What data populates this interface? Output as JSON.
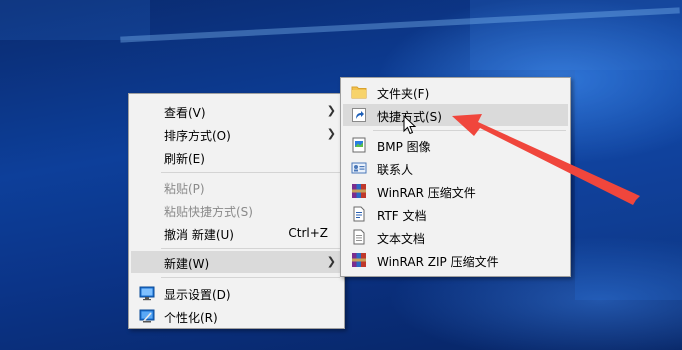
{
  "context_menu": {
    "items": [
      {
        "label": "查看(V)",
        "has_submenu": true
      },
      {
        "label": "排序方式(O)",
        "has_submenu": true
      },
      {
        "label": "刷新(E)"
      },
      {
        "label": "粘贴(P)",
        "disabled": true
      },
      {
        "label": "粘贴快捷方式(S)",
        "disabled": true
      },
      {
        "label": "撤消 新建(U)",
        "shortcut": "Ctrl+Z"
      },
      {
        "label": "新建(W)",
        "has_submenu": true,
        "highlighted": true
      },
      {
        "label": "显示设置(D)",
        "icon": "display-settings-icon"
      },
      {
        "label": "个性化(R)",
        "icon": "personalize-icon"
      }
    ]
  },
  "new_submenu": {
    "items": [
      {
        "label": "文件夹(F)",
        "icon": "folder-icon"
      },
      {
        "label": "快捷方式(S)",
        "icon": "shortcut-icon",
        "highlighted": true
      },
      {
        "label": "BMP 图像",
        "icon": "bmp-image-icon"
      },
      {
        "label": "联系人",
        "icon": "contact-icon"
      },
      {
        "label": "WinRAR 压缩文件",
        "icon": "winrar-icon"
      },
      {
        "label": "RTF 文档",
        "icon": "rtf-document-icon"
      },
      {
        "label": "文本文档",
        "icon": "text-document-icon"
      },
      {
        "label": "WinRAR ZIP 压缩文件",
        "icon": "winrar-zip-icon"
      }
    ]
  },
  "colors": {
    "menu_background": "#f2f2f2",
    "highlight": "#dadada",
    "annotation_arrow": "#f0463c",
    "desktop": "#0d3f9a"
  }
}
